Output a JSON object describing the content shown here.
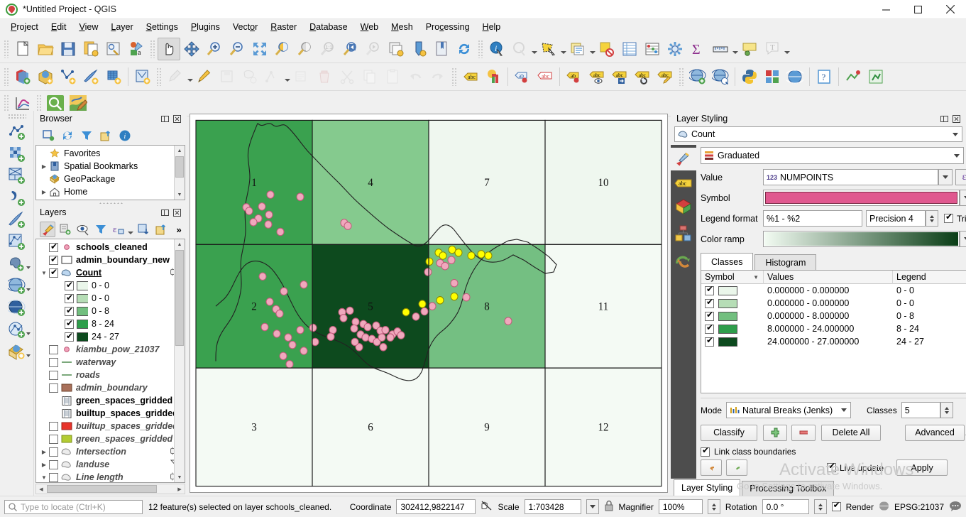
{
  "window": {
    "title": "*Untitled Project - QGIS",
    "minimize": "minimize",
    "maximize": "maximize",
    "close": "close"
  },
  "menubar": [
    {
      "label": "Project"
    },
    {
      "label": "Edit"
    },
    {
      "label": "View"
    },
    {
      "label": "Layer"
    },
    {
      "label": "Settings"
    },
    {
      "label": "Plugins"
    },
    {
      "label": "Vector"
    },
    {
      "label": "Raster"
    },
    {
      "label": "Database"
    },
    {
      "label": "Web"
    },
    {
      "label": "Mesh"
    },
    {
      "label": "Processing"
    },
    {
      "label": "Help"
    }
  ],
  "browser": {
    "title": "Browser",
    "toolbar": [
      "add-layer-icon",
      "refresh-icon",
      "filter-icon",
      "collapse-all-icon",
      "properties-icon"
    ],
    "items": [
      {
        "label": "Favorites",
        "icon": "star-icon",
        "expandable": false
      },
      {
        "label": "Spatial Bookmarks",
        "icon": "bookmark-icon",
        "expandable": true
      },
      {
        "label": "GeoPackage",
        "icon": "geopackage-icon",
        "expandable": false
      },
      {
        "label": "Home",
        "icon": "home-icon",
        "expandable": true
      }
    ]
  },
  "layers": {
    "title": "Layers",
    "toolbar": [
      "styling-dock-icon",
      "add-group-icon",
      "manage-visibility-icon",
      "filter-legend-icon",
      "expression-filter-icon",
      "expand-all-icon",
      "collapse-all-icon",
      "more-icon"
    ],
    "items": [
      {
        "label": "schools_cleaned",
        "checked": true,
        "style": "bold",
        "sym": "point-pink",
        "indent": 1,
        "expander": ""
      },
      {
        "label": "admin_boundary_new",
        "checked": true,
        "style": "bold",
        "sym": "poly-white",
        "indent": 1,
        "expander": ""
      },
      {
        "label": "Count",
        "checked": true,
        "style": "underline",
        "sym": "poly-blue",
        "indent": 1,
        "expander": "down",
        "right": "cpu-icon"
      },
      {
        "label": "0 - 0",
        "checked": true,
        "style": "plain",
        "sym": "ramp0",
        "indent": 2,
        "expander": ""
      },
      {
        "label": "0 - 0",
        "checked": true,
        "style": "plain",
        "sym": "ramp1",
        "indent": 2,
        "expander": ""
      },
      {
        "label": "0 - 8",
        "checked": true,
        "style": "plain",
        "sym": "ramp2",
        "indent": 2,
        "expander": ""
      },
      {
        "label": "8 - 24",
        "checked": true,
        "style": "plain",
        "sym": "ramp3",
        "indent": 2,
        "expander": ""
      },
      {
        "label": "24 - 27",
        "checked": true,
        "style": "plain",
        "sym": "ramp4",
        "indent": 2,
        "expander": ""
      },
      {
        "label": "kiambu_pow_21037",
        "checked": false,
        "style": "italic",
        "sym": "point-pink",
        "indent": 1,
        "expander": ""
      },
      {
        "label": "waterway",
        "checked": false,
        "style": "italic",
        "sym": "line-green",
        "indent": 1,
        "expander": ""
      },
      {
        "label": "roads",
        "checked": false,
        "style": "italic",
        "sym": "line-green",
        "indent": 1,
        "expander": ""
      },
      {
        "label": "admin_boundary",
        "checked": false,
        "style": "italic",
        "sym": "poly-brown",
        "indent": 1,
        "expander": ""
      },
      {
        "label": "green_spaces_gridded",
        "checked": null,
        "style": "bold",
        "sym": "raster-icon",
        "indent": 1,
        "expander": ""
      },
      {
        "label": "builtup_spaces_gridded",
        "checked": null,
        "style": "bold",
        "sym": "raster-icon",
        "indent": 1,
        "expander": ""
      },
      {
        "label": "builtup_spaces_gridded",
        "checked": false,
        "style": "italic",
        "sym": "poly-red",
        "indent": 1,
        "expander": ""
      },
      {
        "label": "green_spaces_gridded",
        "checked": false,
        "style": "italic",
        "sym": "poly-olive",
        "indent": 1,
        "expander": ""
      },
      {
        "label": "Intersection",
        "checked": false,
        "style": "italic",
        "sym": "poly-grey",
        "indent": 1,
        "expander": "right",
        "right": "cpu-icon"
      },
      {
        "label": "landuse",
        "checked": false,
        "style": "italic",
        "sym": "poly-grey",
        "indent": 1,
        "expander": "right",
        "right": "filter-icon"
      },
      {
        "label": "Line length",
        "checked": false,
        "style": "italic",
        "sym": "poly-grey",
        "indent": 1,
        "expander": "down",
        "right": "cpu-icon"
      }
    ]
  },
  "map": {
    "grid_labels": [
      "1",
      "4",
      "7",
      "10",
      "2",
      "5",
      "8",
      "11",
      "3",
      "6",
      "9",
      "12"
    ],
    "cell_fills": [
      "#3aa14f",
      "#85ca8e",
      "#eff7ef",
      "#eff7ef",
      "#3aa14f",
      "#0d4a1e",
      "#74bf82",
      "#f4faf4",
      "#f4faf4",
      "#f4faf4",
      "#f4faf4",
      "#f4faf4"
    ],
    "point_color_unselected": "#f0a8bd",
    "point_color_selected": "#ffff00"
  },
  "styling": {
    "title": "Layer Styling",
    "layer_selector": "Count",
    "renderer": "Graduated",
    "value_label": "Value",
    "value_field": "NUMPOINTS",
    "value_field_prefix": "123",
    "symbol_label": "Symbol",
    "symbol_color": "#e0588f",
    "legend_format_label": "Legend format",
    "legend_format": "%1 - %2",
    "precision": "Precision 4",
    "trim_label": "Trim",
    "trim_checked": true,
    "color_ramp_label": "Color ramp",
    "ramp_start": "#f2fbf2",
    "ramp_end": "#0a3d16",
    "tabs": [
      {
        "label": "Classes",
        "active": true
      },
      {
        "label": "Histogram",
        "active": false
      }
    ],
    "table": {
      "headers": [
        "Symbol",
        "Values",
        "Legend"
      ],
      "rows": [
        {
          "checked": true,
          "color": "#eaf6ea",
          "values": "0.000000 - 0.000000",
          "legend": "0 - 0"
        },
        {
          "checked": true,
          "color": "#b6ddb6",
          "values": "0.000000 - 0.000000",
          "legend": "0 - 0"
        },
        {
          "checked": true,
          "color": "#72bf7f",
          "values": "0.000000 - 8.000000",
          "legend": "0 - 8"
        },
        {
          "checked": true,
          "color": "#2e9e4b",
          "values": "8.000000 - 24.000000",
          "legend": "8 - 24"
        },
        {
          "checked": true,
          "color": "#0d4a1e",
          "values": "24.000000 - 27.000000",
          "legend": "24 - 27"
        }
      ]
    },
    "mode_label": "Mode",
    "mode_value": "Natural Breaks (Jenks)",
    "classes_label": "Classes",
    "classes_value": "5",
    "classify_button": "Classify",
    "add_button": "add-class",
    "remove_button": "remove-class",
    "delete_all_button": "Delete All",
    "advanced_button": "Advanced",
    "link_class_boundaries_label": "Link class boundaries",
    "link_class_boundaries_checked": true,
    "undo_button": "undo",
    "redo_button": "redo",
    "live_update_label": "Live update",
    "live_update_checked": true,
    "apply_button": "Apply"
  },
  "dock_tabs": [
    {
      "label": "Layer Styling",
      "active": true
    },
    {
      "label": "Processing Toolbox",
      "active": false
    }
  ],
  "watermark": {
    "line1": "Activate Windows",
    "line2": "Go to Settings to activate Windows."
  },
  "statusbar": {
    "locate_placeholder": "Type to locate (Ctrl+K)",
    "message": "12 feature(s) selected on layer schools_cleaned.",
    "coordinate_label": "Coordinate",
    "coordinate_value": "302412,9822147",
    "scale_label": "Scale",
    "scale_value": "1:703428",
    "magnifier_label": "Magnifier",
    "magnifier_value": "100%",
    "rotation_label": "Rotation",
    "rotation_value": "0.0 °",
    "render_label": "Render",
    "render_checked": true,
    "crs_value": "EPSG:21037",
    "messages_icon": "messages-icon"
  }
}
